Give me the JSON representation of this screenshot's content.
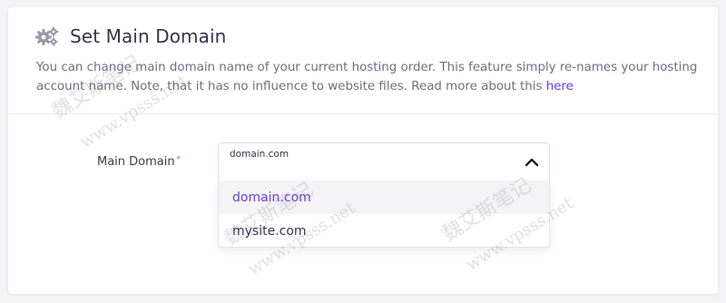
{
  "header": {
    "title": "Set Main Domain",
    "description": "You can change main domain name of your current hosting order. This feature simply re-names your hosting account name. Note, that it has no influence to website files. Read more about this",
    "link_text": "here"
  },
  "form": {
    "label": "Main Domain",
    "required_mark": "*",
    "selected_value": "domain.com",
    "options": [
      "domain.com",
      "mysite.com"
    ]
  },
  "watermark": {
    "cn": "魏艾斯笔记",
    "url": "www.vpsss.net"
  },
  "colors": {
    "accent": "#673de6",
    "required": "#fc5185",
    "text": "#36344d",
    "muted": "#6d7081"
  }
}
